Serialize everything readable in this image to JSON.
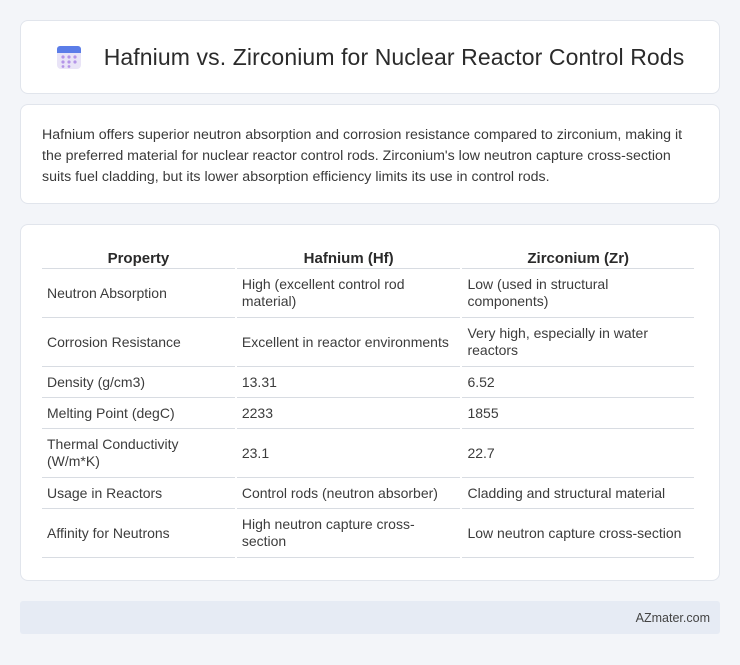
{
  "header": {
    "title": "Hafnium vs. Zirconium for Nuclear Reactor Control Rods",
    "icon": "calendar-icon",
    "icon_colors": {
      "top": "#5b7de8",
      "body": "#e9e4f7",
      "dots": "#b495e8"
    }
  },
  "summary": {
    "text": "Hafnium offers superior neutron absorption and corrosion resistance compared to zirconium, making it the preferred material for nuclear reactor control rods. Zirconium's low neutron capture cross-section suits fuel cladding, but its lower absorption efficiency limits its use in control rods."
  },
  "table": {
    "headers": [
      "Property",
      "Hafnium (Hf)",
      "Zirconium (Zr)"
    ],
    "rows": [
      [
        "Neutron Absorption",
        "High (excellent control rod material)",
        "Low (used in structural components)"
      ],
      [
        "Corrosion Resistance",
        "Excellent in reactor environments",
        "Very high, especially in water reactors"
      ],
      [
        "Density (g/cm3)",
        "13.31",
        "6.52"
      ],
      [
        "Melting Point (degC)",
        "2233",
        "1855"
      ],
      [
        "Thermal Conductivity (W/m*K)",
        "23.1",
        "22.7"
      ],
      [
        "Usage in Reactors",
        "Control rods (neutron absorber)",
        "Cladding and structural material"
      ],
      [
        "Affinity for Neutrons",
        "High neutron capture cross-section",
        "Low neutron capture cross-section"
      ]
    ]
  },
  "footer": {
    "brand": "AZmater.com"
  }
}
